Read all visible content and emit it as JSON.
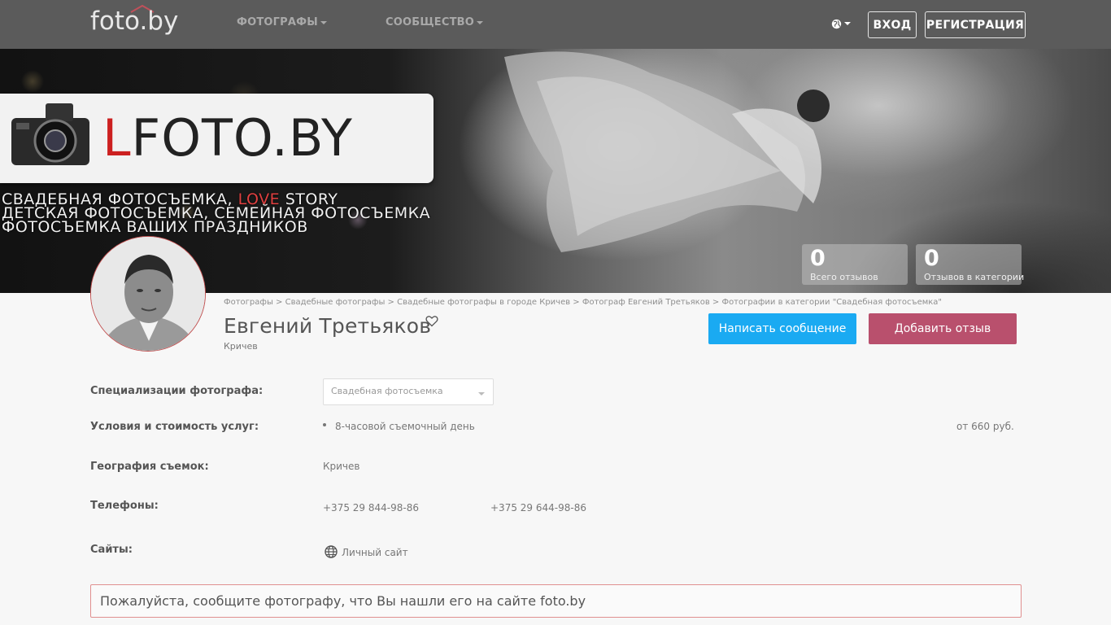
{
  "header": {
    "logo": "foto.by",
    "nav": [
      {
        "label": "ФОТОГРАФЫ"
      },
      {
        "label": "СООБЩЕСТВО"
      }
    ],
    "login": "ВХОД",
    "register": "РЕГИСТРАЦИЯ"
  },
  "cover": {
    "brand_prefix": "L",
    "brand_rest": "FOTO.BY",
    "slogan_line1_a": "СВАДЕБНАЯ ФОТОСЪЕМКА, ",
    "slogan_line1_love": "LOVE",
    "slogan_line1_b": " STORY",
    "slogan_line2": "ДЕТСКАЯ ФОТОСЪЕМКА, СЕМЕЙНАЯ ФОТОСЪЕМКА",
    "slogan_line3": "ФОТОСЪЕМКА ВАШИХ ПРАЗДНИКОВ",
    "stats": [
      {
        "value": "0",
        "label": "Всего отзывов"
      },
      {
        "value": "0",
        "label": "Отзывов в категории"
      }
    ]
  },
  "breadcrumbs": "Фотографы > Свадебные фотографы > Свадебные фотографы в городе Кричев > Фотограф Евгений Третьяков > Фотографии в категории \"Свадебная фотосъемка\"",
  "profile": {
    "name": "Евгений Третьяков",
    "city": "Кричев",
    "write_message": "Написать сообщение",
    "add_review": "Добавить отзыв"
  },
  "details": {
    "specializations_label": "Специализации фотографа:",
    "specialization_selected": "Свадебная фотосъемка",
    "services_label": "Условия и стоимость услуг:",
    "service_name": "8-часовой съемочный день",
    "service_price": "от 660 руб.",
    "geography_label": "География съемок:",
    "geography_value": "Кричев",
    "phones_label": "Телефоны:",
    "phones": [
      "+375 29 844-98-86",
      "+375 29 644-98-86"
    ],
    "sites_label": "Сайты:",
    "site_link": "Личный сайт"
  },
  "notice": "Пожалуйста, сообщите фотографу, что Вы нашли его на сайте foto.by",
  "colors": {
    "header_bg": "#5b5b5b",
    "message_button": "#1aaaf2",
    "review_button": "#b9506d",
    "notice_border": "#e09090"
  }
}
